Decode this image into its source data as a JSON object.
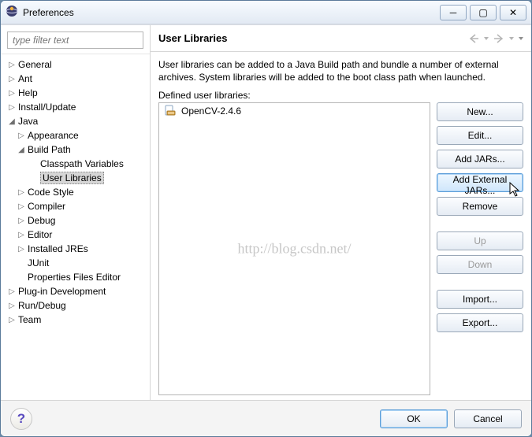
{
  "window": {
    "title": "Preferences"
  },
  "filter": {
    "placeholder": "type filter text"
  },
  "tree": {
    "general": "General",
    "ant": "Ant",
    "help": "Help",
    "install": "Install/Update",
    "java": "Java",
    "java_appearance": "Appearance",
    "java_buildpath": "Build Path",
    "java_bp_classpath": "Classpath Variables",
    "java_bp_userlib": "User Libraries",
    "java_codestyle": "Code Style",
    "java_compiler": "Compiler",
    "java_debug": "Debug",
    "java_editor": "Editor",
    "java_jres": "Installed JREs",
    "java_junit": "JUnit",
    "java_propfiles": "Properties Files Editor",
    "plugin": "Plug-in Development",
    "run": "Run/Debug",
    "team": "Team"
  },
  "main": {
    "heading": "User Libraries",
    "description": "User libraries can be added to a Java Build path and bundle a number of external archives. System libraries will be added to the boot class path when launched.",
    "defined_label": "Defined user libraries:",
    "items": [
      {
        "label": "OpenCV-2.4.6"
      }
    ]
  },
  "watermark": "http://blog.csdn.net/",
  "buttons": {
    "new": "New...",
    "edit": "Edit...",
    "add_jars": "Add JARs...",
    "add_ext_jars": "Add External JARs...",
    "remove": "Remove",
    "up": "Up",
    "down": "Down",
    "import": "Import...",
    "export": "Export...",
    "ok": "OK",
    "cancel": "Cancel"
  }
}
